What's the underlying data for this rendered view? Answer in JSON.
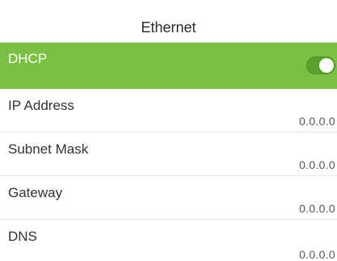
{
  "header": {
    "title": "Ethernet"
  },
  "dhcp": {
    "label": "DHCP",
    "enabled": true,
    "accent_color": "#7ac143",
    "toggle_icon": "toggle-on-icon"
  },
  "fields": [
    {
      "label": "IP Address",
      "value": "0.0.0.0"
    },
    {
      "label": "Subnet Mask",
      "value": "0.0.0.0"
    },
    {
      "label": "Gateway",
      "value": "0.0.0.0"
    },
    {
      "label": "DNS",
      "value": "0.0.0.0"
    }
  ]
}
